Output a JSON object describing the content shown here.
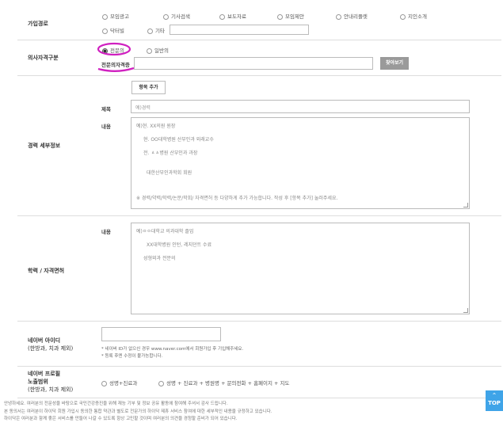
{
  "join_path": {
    "label": "가입경로",
    "options": [
      "모임광고",
      "기사검색",
      "보도자료",
      "모임제안",
      "안내리플렛",
      "지인소개",
      "닥터빌",
      "기타"
    ]
  },
  "doctor_type": {
    "label": "의사자격구분",
    "options": [
      "전문의",
      "일반의"
    ],
    "sub_label": "전문의자격증",
    "browse_label": "찾아보기"
  },
  "career": {
    "label": "경력 세부정보",
    "add_button": "항목 추가",
    "title_label": "제목",
    "title_placeholder": "예)경력",
    "content_label": "내용",
    "content_lines": [
      "예)현. XX의원 원장",
      "현. OO대학병원 산부인과 외래교수",
      "전. ㅿㅿ병원 산부인과 과장",
      "대한산부인과학회 회원",
      "※ 경력/약력/학력/논문/학회/ 자격면허 등 다양하게 추가 가능합니다. 작성 후 [항목 추가] 눌러주세요."
    ]
  },
  "education": {
    "label": "학력 / 자격면허",
    "content_label": "내용",
    "content_lines": [
      "예)ㅇㅇ대학교 의과대학 졸업",
      "XX대학병원 인턴, 레지던트 수료",
      "성형외과 전문의"
    ]
  },
  "naver": {
    "label_lines": [
      "네이버 아이디",
      "(한방과, 치과 제외)"
    ],
    "notes": [
      "* 네이버 ID가 없으신 경우 www.naver.com에서 회원가입 후 기입해주세요.",
      "* 등록 후엔 수정이 불가능합니다."
    ]
  },
  "exposure": {
    "label_lines": [
      "네이버 프로필",
      "노출범위",
      "(한방과, 치과 제외)"
    ],
    "options": [
      "성명+진료과",
      "성명 + 진료과 + 병원명 + 문의전화 + 홈페이지 + 지도"
    ]
  },
  "footer_lines": [
    "안녕하세요. 여러분의 전문성을 바탕으로 국민건강증진을 위해 재능 기부 및 정보 공유 활동에 참여해 주셔서 감사 드립니다.",
    "본 동의서는 여러분이 하이닥 회원 가입시 동의한 통합 약관과 별도로 전문가의 하이닥 제휴 서비스 참여에 대한 세부적인 내용을 규정하고 있습니다.",
    "하이닥은 여러분과 함께 좋은 서비스를 만들어 나갈 수 있도록 항상 고민할 것이며 여러분의 의견을 경청할 준비가 되어 있습니다."
  ],
  "top_button": "TOP",
  "colors": {
    "highlight": "#d020c0",
    "top_button_bg": "#3fa4e8",
    "browse_bg": "#9a9a9a"
  }
}
